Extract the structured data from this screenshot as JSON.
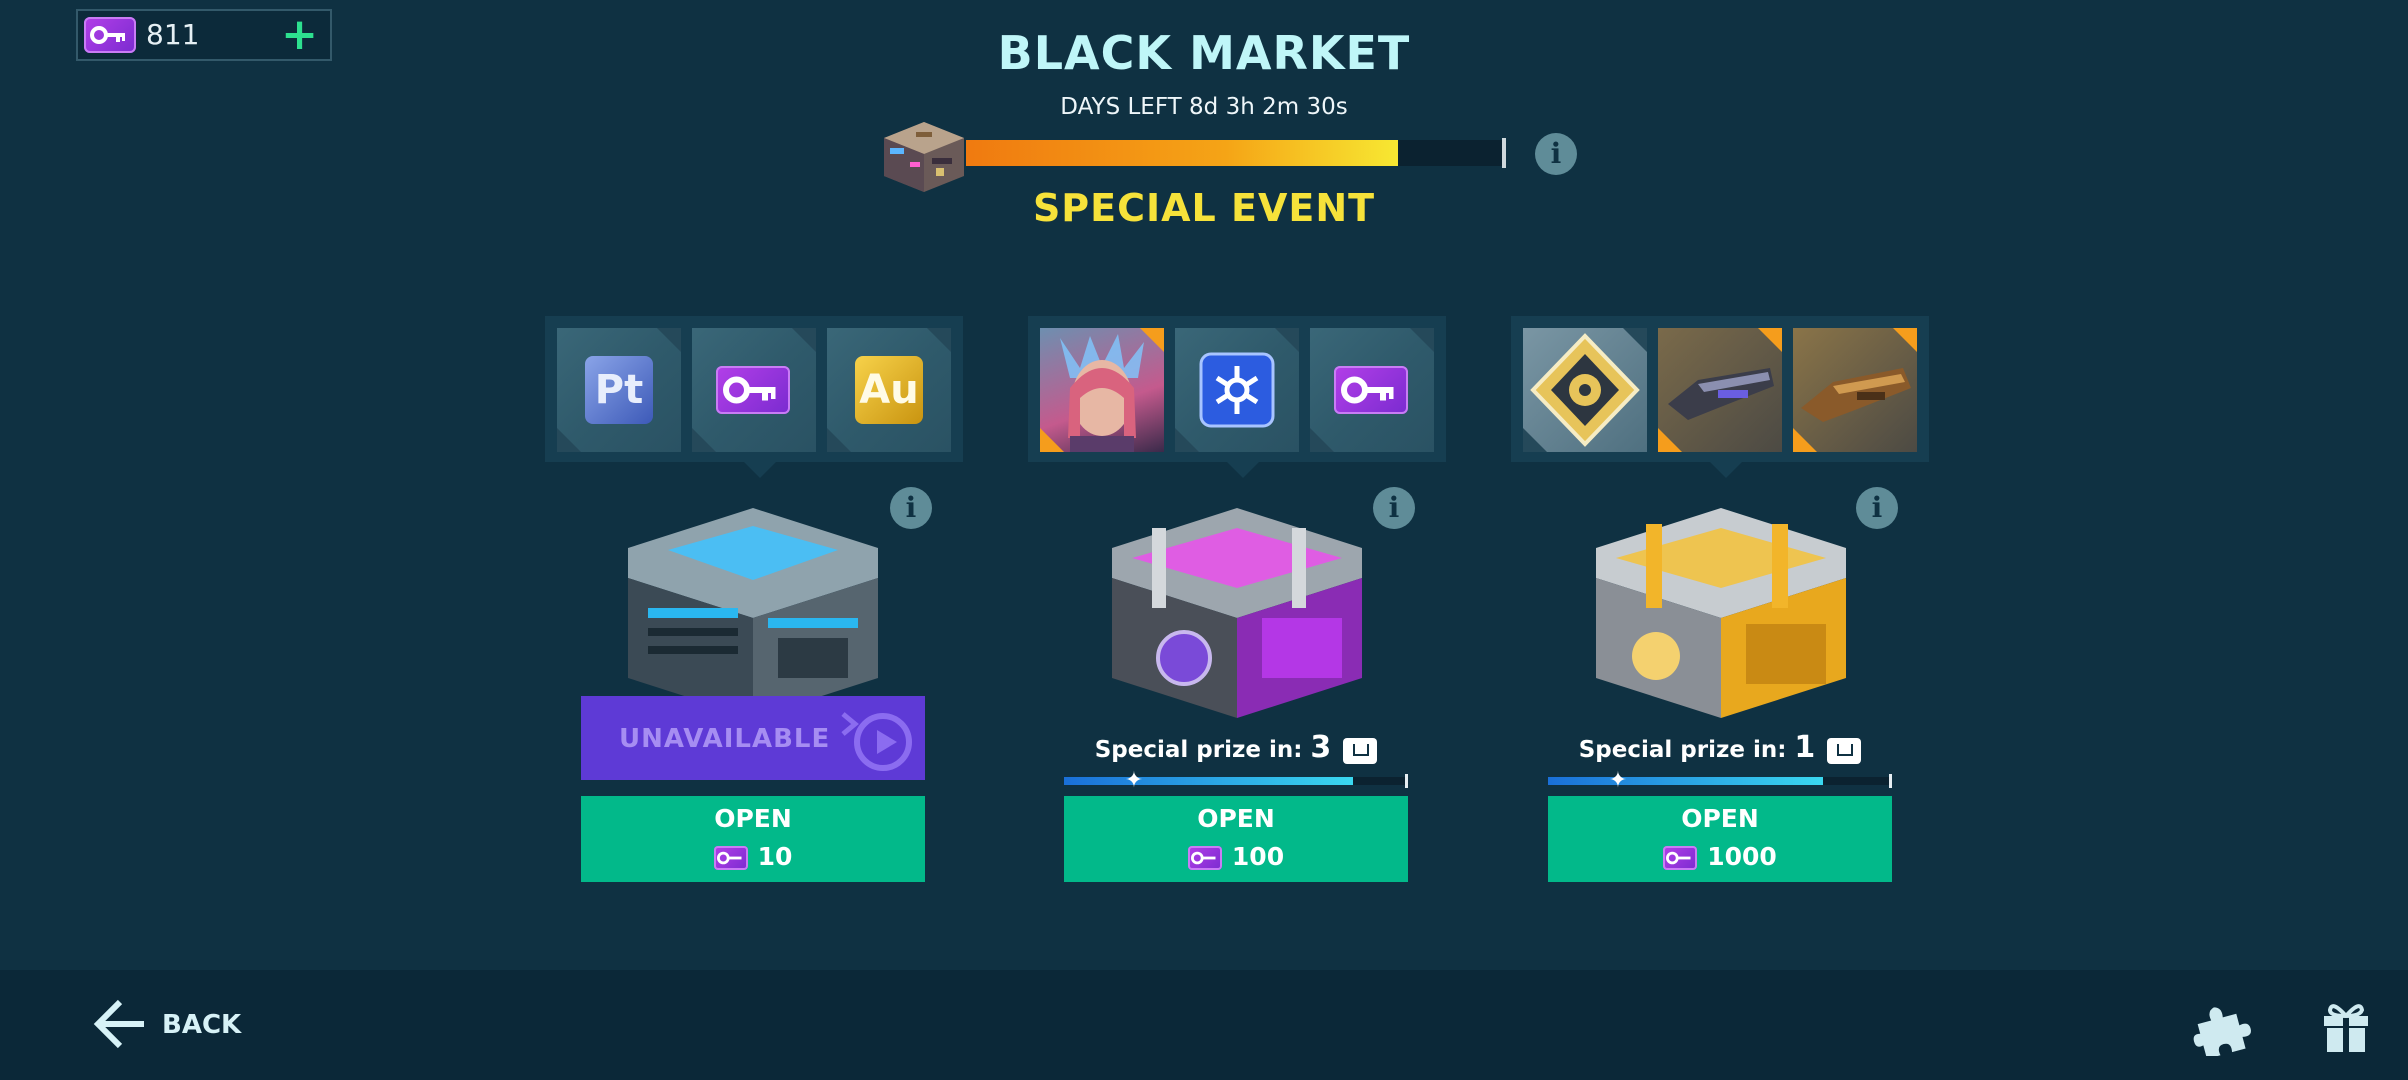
{
  "currency": {
    "amount": "811",
    "icon": "key-ticket-icon",
    "add_icon": "plus-icon"
  },
  "header": {
    "title": "BLACK MARKET",
    "days_left": "DAYS LEFT 8d 3h 2m 30s",
    "progress_fraction": 0.8,
    "event_label": "SPECIAL EVENT"
  },
  "chests": [
    {
      "color": "blue",
      "rewards": [
        "platinum-icon",
        "key-ticket-icon",
        "gold-icon"
      ],
      "reward_texts": [
        "Pt",
        "Au"
      ],
      "status": "UNAVAILABLE",
      "open_label": "OPEN",
      "price": "10"
    },
    {
      "color": "purple",
      "rewards": [
        "pilot-portrait-icon",
        "module-icon",
        "key-ticket-icon"
      ],
      "prize_label": "Special prize in:",
      "prize_count": "3",
      "prize_progress": 0.84,
      "open_label": "OPEN",
      "price": "100"
    },
    {
      "color": "gold",
      "rewards": [
        "emblem-icon",
        "dark-weapon-icon",
        "bronze-weapon-icon"
      ],
      "prize_label": "Special prize in:",
      "prize_count": "1",
      "prize_progress": 0.8,
      "open_label": "OPEN",
      "price": "1000"
    }
  ],
  "footer": {
    "back_label": "BACK",
    "icons": [
      "puzzle-icon",
      "gift-icon"
    ]
  },
  "colors": {
    "background": "#0f3142",
    "accent_green": "#02b98a",
    "title": "#bff6f8",
    "event_yellow": "#f6e23a",
    "unavailable_purple": "#5e3ad6"
  }
}
